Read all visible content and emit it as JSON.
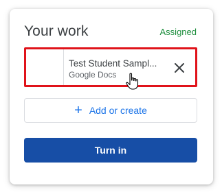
{
  "card": {
    "title": "Your work",
    "status": "Assigned"
  },
  "attachment": {
    "name": "Test Student Sampl...",
    "type": "Google Docs",
    "remove_icon": "close-icon"
  },
  "buttons": {
    "add_or_create_label": "Add or create",
    "add_icon": "plus-icon",
    "turn_in_label": "Turn in"
  },
  "colors": {
    "status": "#1e8e3e",
    "accent": "#1a73e8",
    "primary_button": "#174ea6",
    "highlight_border": "#e0131a"
  }
}
